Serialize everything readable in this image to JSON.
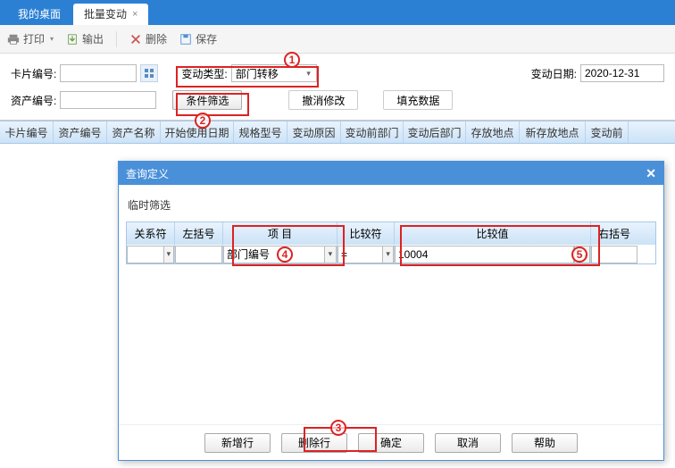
{
  "tabs": {
    "desktop": "我的桌面",
    "active": "批量变动"
  },
  "toolbar": {
    "print": "打印",
    "export": "输出",
    "delete": "删除",
    "save": "保存"
  },
  "filters": {
    "card_no_lbl": "卡片编号:",
    "change_type_lbl": "变动类型:",
    "change_type_val": "部门转移",
    "change_date_lbl": "变动日期:",
    "change_date_val": "2020-12-31",
    "asset_no_lbl": "资产编号:",
    "filter_btn": "条件筛选",
    "undo_btn": "撤消修改",
    "fill_btn": "填充数据"
  },
  "grid_headers": [
    "卡片编号",
    "资产编号",
    "资产名称",
    "开始使用日期",
    "规格型号",
    "变动原因",
    "变动前部门",
    "变动后部门",
    "存放地点",
    "新存放地点",
    "变动前"
  ],
  "dialog": {
    "title": "查询定义",
    "subtitle": "临时筛选",
    "headers": {
      "rel": "关系符",
      "lparen": "左括号",
      "item": "项    目",
      "cmp": "比较符",
      "val": "比较值",
      "rparen": "右括号"
    },
    "row": {
      "rel": "",
      "lparen": "",
      "item": "部门编号",
      "cmp": "=",
      "val": "10004",
      "rparen": ""
    },
    "buttons": {
      "add": "新增行",
      "del": "删除行",
      "ok": "确定",
      "cancel": "取消",
      "help": "帮助"
    }
  },
  "annos": {
    "n1": "1",
    "n2": "2",
    "n3": "3",
    "n4": "4",
    "n5": "5"
  }
}
